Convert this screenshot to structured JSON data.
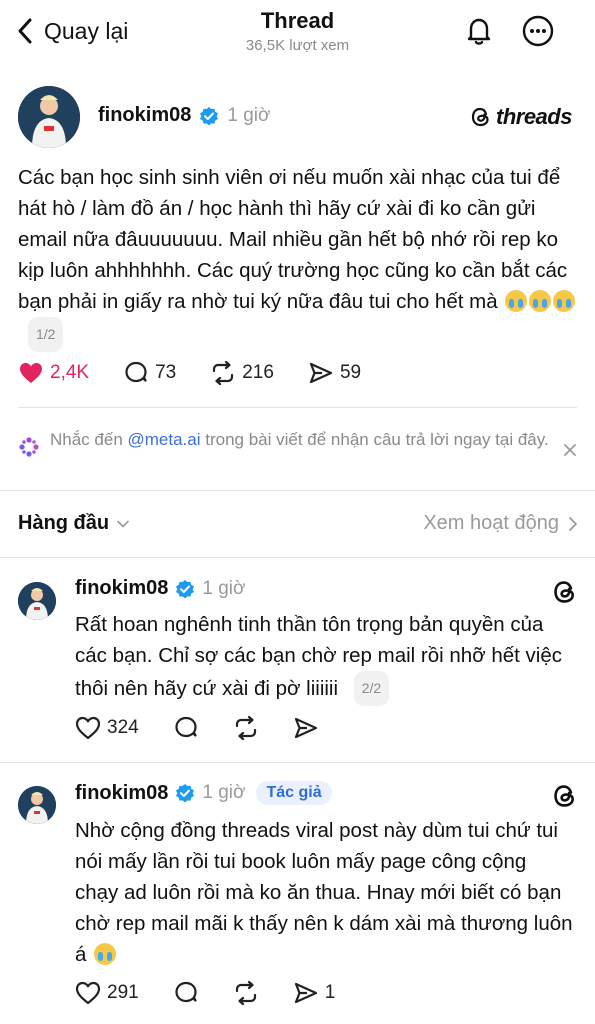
{
  "header": {
    "back_label": "Quay lại",
    "title": "Thread",
    "views": "36,5K lượt xem"
  },
  "post": {
    "username": "finokim08",
    "time": "1 giờ",
    "brand": "threads",
    "text": "Các bạn học sinh sinh viên ơi nếu muốn xài nhạc của tui để hát hò / làm đồ án / học hành thì hãy cứ xài đi ko cần gửi email nữa đâuuuuuuu. Mail nhiều gần hết bộ nhớ rồi rep ko kịp luôn ahhhhhhh. Các quý trường học cũng ko cần bắt các bạn phải in giấy ra nhờ tui ký nữa đâu tui cho hết mà",
    "pager": "1/2",
    "likes": "2,4K",
    "replies": "73",
    "reposts": "216",
    "shares": "59"
  },
  "meta_hint": {
    "prefix": "Nhắc đến ",
    "handle": "@meta.ai",
    "suffix": " trong bài viết để nhận câu trả lời ngay tại đây."
  },
  "sort": {
    "label": "Hàng đầu",
    "activity": "Xem hoạt động"
  },
  "replies": [
    {
      "username": "finokim08",
      "time": "1 giờ",
      "text": "Rất hoan nghênh tinh thần tôn trọng bản quyền của các bạn. Chỉ sợ các bạn chờ rep mail rồi nhỡ hết việc thôi nên hãy cứ xài đi pờ liiiiii",
      "pager": "2/2",
      "likes": "324"
    },
    {
      "username": "finokim08",
      "time": "1 giờ",
      "badge": "Tác giả",
      "text": "Nhờ cộng đồng threads viral post này dùm tui chứ tui nói mấy lần rồi tui book luôn mấy page công cộng chạy ad luôn rồi mà ko ăn thua. Hnay mới biết có bạn chờ rep mail mãi k thấy nên k dám xài mà thương luôn á",
      "likes": "291",
      "shares": "1"
    }
  ],
  "colors": {
    "like": "#e0245e",
    "verified": "#1d9bf0",
    "link": "#3a6fd8"
  }
}
